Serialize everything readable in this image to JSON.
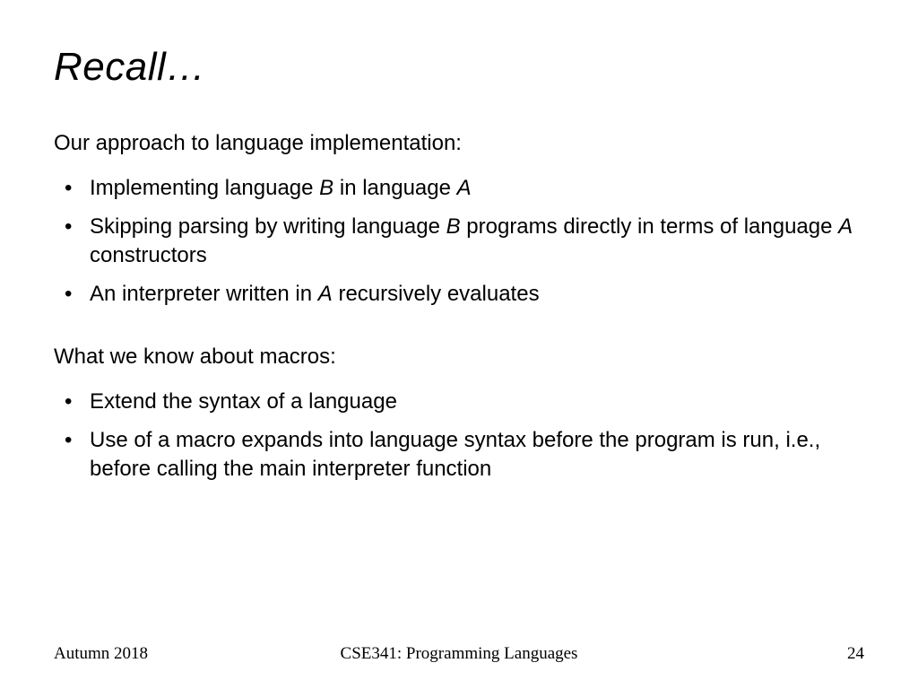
{
  "title": "Recall…",
  "intro1": "Our approach to language implementation:",
  "list1": {
    "i0": {
      "pre": "Implementing language ",
      "b": "B",
      "mid": " in language ",
      "a": "A",
      "post": ""
    },
    "i1": {
      "pre": "Skipping parsing by writing language ",
      "b": "B",
      "mid": " programs directly in terms of language ",
      "a": "A",
      "post": " constructors"
    },
    "i2": {
      "pre": "An interpreter written in ",
      "a": "A",
      "post": " recursively evaluates"
    }
  },
  "intro2": "What we know about macros:",
  "list2": {
    "i0": "Extend the syntax of a language",
    "i1": "Use of a macro expands into language syntax before the program is run, i.e., before calling the main interpreter function"
  },
  "footer": {
    "left": "Autumn 2018",
    "center": "CSE341: Programming Languages",
    "right": "24"
  }
}
